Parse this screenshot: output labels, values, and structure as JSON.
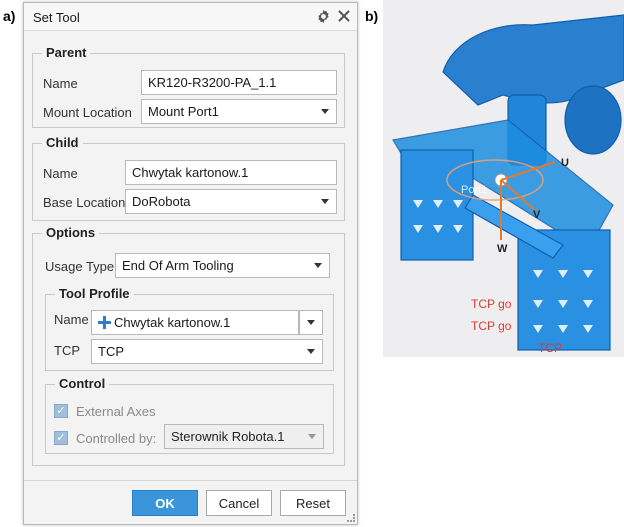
{
  "figure_labels": {
    "a": "a)",
    "b": "b)"
  },
  "dialog": {
    "title": "Set Tool",
    "parent": {
      "title": "Parent",
      "name_label": "Name",
      "name_value": "KR120-R3200-PA_1.1",
      "mount_label": "Mount Location",
      "mount_value": "Mount Port1"
    },
    "child": {
      "title": "Child",
      "name_label": "Name",
      "name_value": "Chwytak kartonow.1",
      "base_label": "Base Location",
      "base_value": "DoRobota"
    },
    "options": {
      "title": "Options",
      "usage_label": "Usage Type",
      "usage_value": "End Of Arm Tooling",
      "tool_profile": {
        "title": "Tool Profile",
        "name_label": "Name",
        "name_value": "Chwytak kartonow.1",
        "tcp_label": "TCP",
        "tcp_value": "TCP"
      },
      "control": {
        "title": "Control",
        "external_axes_label": "External Axes",
        "external_axes_checked": true,
        "controlled_by_label": "Controlled by:",
        "controlled_by_checked": true,
        "controlled_by_value": "Sterownik Robota.1"
      }
    },
    "buttons": {
      "ok": "OK",
      "cancel": "Cancel",
      "reset": "Reset"
    }
  },
  "viewport": {
    "axis_u": "U",
    "axis_v": "V",
    "axis_w": "W",
    "port_label": "Port1",
    "tcp_go_1": "TCP go",
    "tcp_go_2": "TCP go",
    "tcp_label": "TCP",
    "colors": {
      "model": "#1e8ee0",
      "model_dark": "#1565b0",
      "background": "#eeeef0",
      "tcp_text": "#e03a32"
    }
  }
}
